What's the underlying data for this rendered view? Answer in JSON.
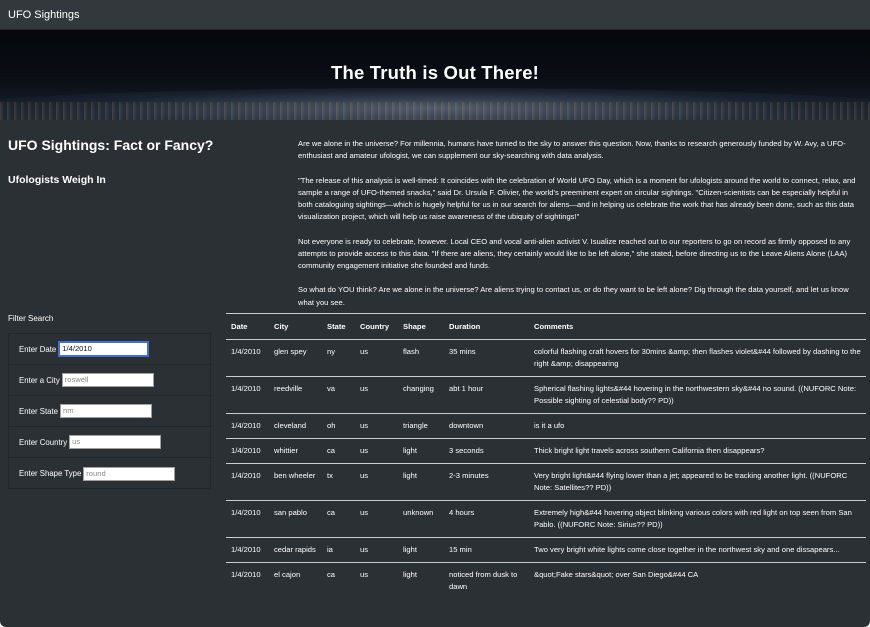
{
  "navbar": {
    "brand": "UFO Sightings"
  },
  "hero": {
    "title": "The Truth is Out There!"
  },
  "left": {
    "section_title": "UFO Sightings: Fact or Fancy?",
    "subtitle": "Ufologists Weigh In"
  },
  "article": {
    "paragraphs": [
      "Are we alone in the universe? For millennia, humans have turned to the sky to answer this question. Now, thanks to research generously funded by W. Avy, a UFO-enthusiast and amateur ufologist, we can supplement our sky-searching with data analysis.",
      "\"The release of this analysis is well-timed: It coincides with the celebration of World UFO Day, which is a moment for ufologists around the world to connect, relax, and sample a range of UFO-themed snacks,\" said Dr. Ursula F. Olivier, the world's preeminent expert on circular sightings. \"Citizen-scientists can be especially helpful in both cataloguing sightings—which is hugely helpful for us in our search for aliens—and in helping us celebrate the work that has already been done, such as this data visualization project, which will help us raise awareness of the ubiquity of sightings!\"",
      "Not everyone is ready to celebrate, however. Local CEO and vocal anti-alien activist V. Isualize reached out to our reporters to go on record as firmly opposed to any attempts to provide access to this data. \"If there are aliens, they certainly would like to be left alone,\" she stated, before directing us to the Leave Aliens Alone (LAA) community engagement initiative she founded and funds.",
      "So what do YOU think? Are we alone in the universe? Are aliens trying to contact us, or do they want to be left alone? Dig through the data yourself, and let us know what you see."
    ]
  },
  "filters": {
    "heading": "Filter Search",
    "date": {
      "label": "Enter Date",
      "value": "1/4/2010"
    },
    "city": {
      "label": "Enter a City",
      "placeholder": "roswell"
    },
    "state": {
      "label": "Enter State",
      "placeholder": "nm"
    },
    "country": {
      "label": "Enter Country",
      "placeholder": "us"
    },
    "shape": {
      "label": "Enter Shape Type",
      "placeholder": "round"
    }
  },
  "table": {
    "headers": [
      "Date",
      "City",
      "State",
      "Country",
      "Shape",
      "Duration",
      "Comments"
    ],
    "rows": [
      [
        "1/4/2010",
        "glen spey",
        "ny",
        "us",
        "flash",
        "35 mins",
        "colorful flashing craft hovers for 30mins &amp; then flashes violet&#44 followed by dashing to the right &amp; disappearing"
      ],
      [
        "1/4/2010",
        "reedville",
        "va",
        "us",
        "changing",
        "abt 1 hour",
        "Spherical flashing lights&#44 hovering in the northwestern sky&#44 no sound. ((NUFORC Note: Possible sighting of celestial body?? PD))"
      ],
      [
        "1/4/2010",
        "cleveland",
        "oh",
        "us",
        "triangle",
        "downtown",
        "is it a ufo"
      ],
      [
        "1/4/2010",
        "whittier",
        "ca",
        "us",
        "light",
        "3 seconds",
        "Thick bright light travels across southern California then disappears?"
      ],
      [
        "1/4/2010",
        "ben wheeler",
        "tx",
        "us",
        "light",
        "2-3 minutes",
        "Very bright light&#44 flying lower than a jet; appeared to be tracking another light. ((NUFORC Note: Satellites?? PD))"
      ],
      [
        "1/4/2010",
        "san pablo",
        "ca",
        "us",
        "unknown",
        "4 hours",
        "Extremely high&#44 hovering object blinking various colors with red light on top seen from San Pablo. ((NUFORC Note: Sirius?? PD))"
      ],
      [
        "1/4/2010",
        "cedar rapids",
        "ia",
        "us",
        "light",
        "15 min",
        "Two very bright white lights come close together in the northwest sky and one dissapears..."
      ],
      [
        "1/4/2010",
        "el cajon",
        "ca",
        "us",
        "light",
        "noticed from dusk to dawn",
        "&quot;Fake stars&quot; over San Diego&#44 CA"
      ]
    ]
  }
}
